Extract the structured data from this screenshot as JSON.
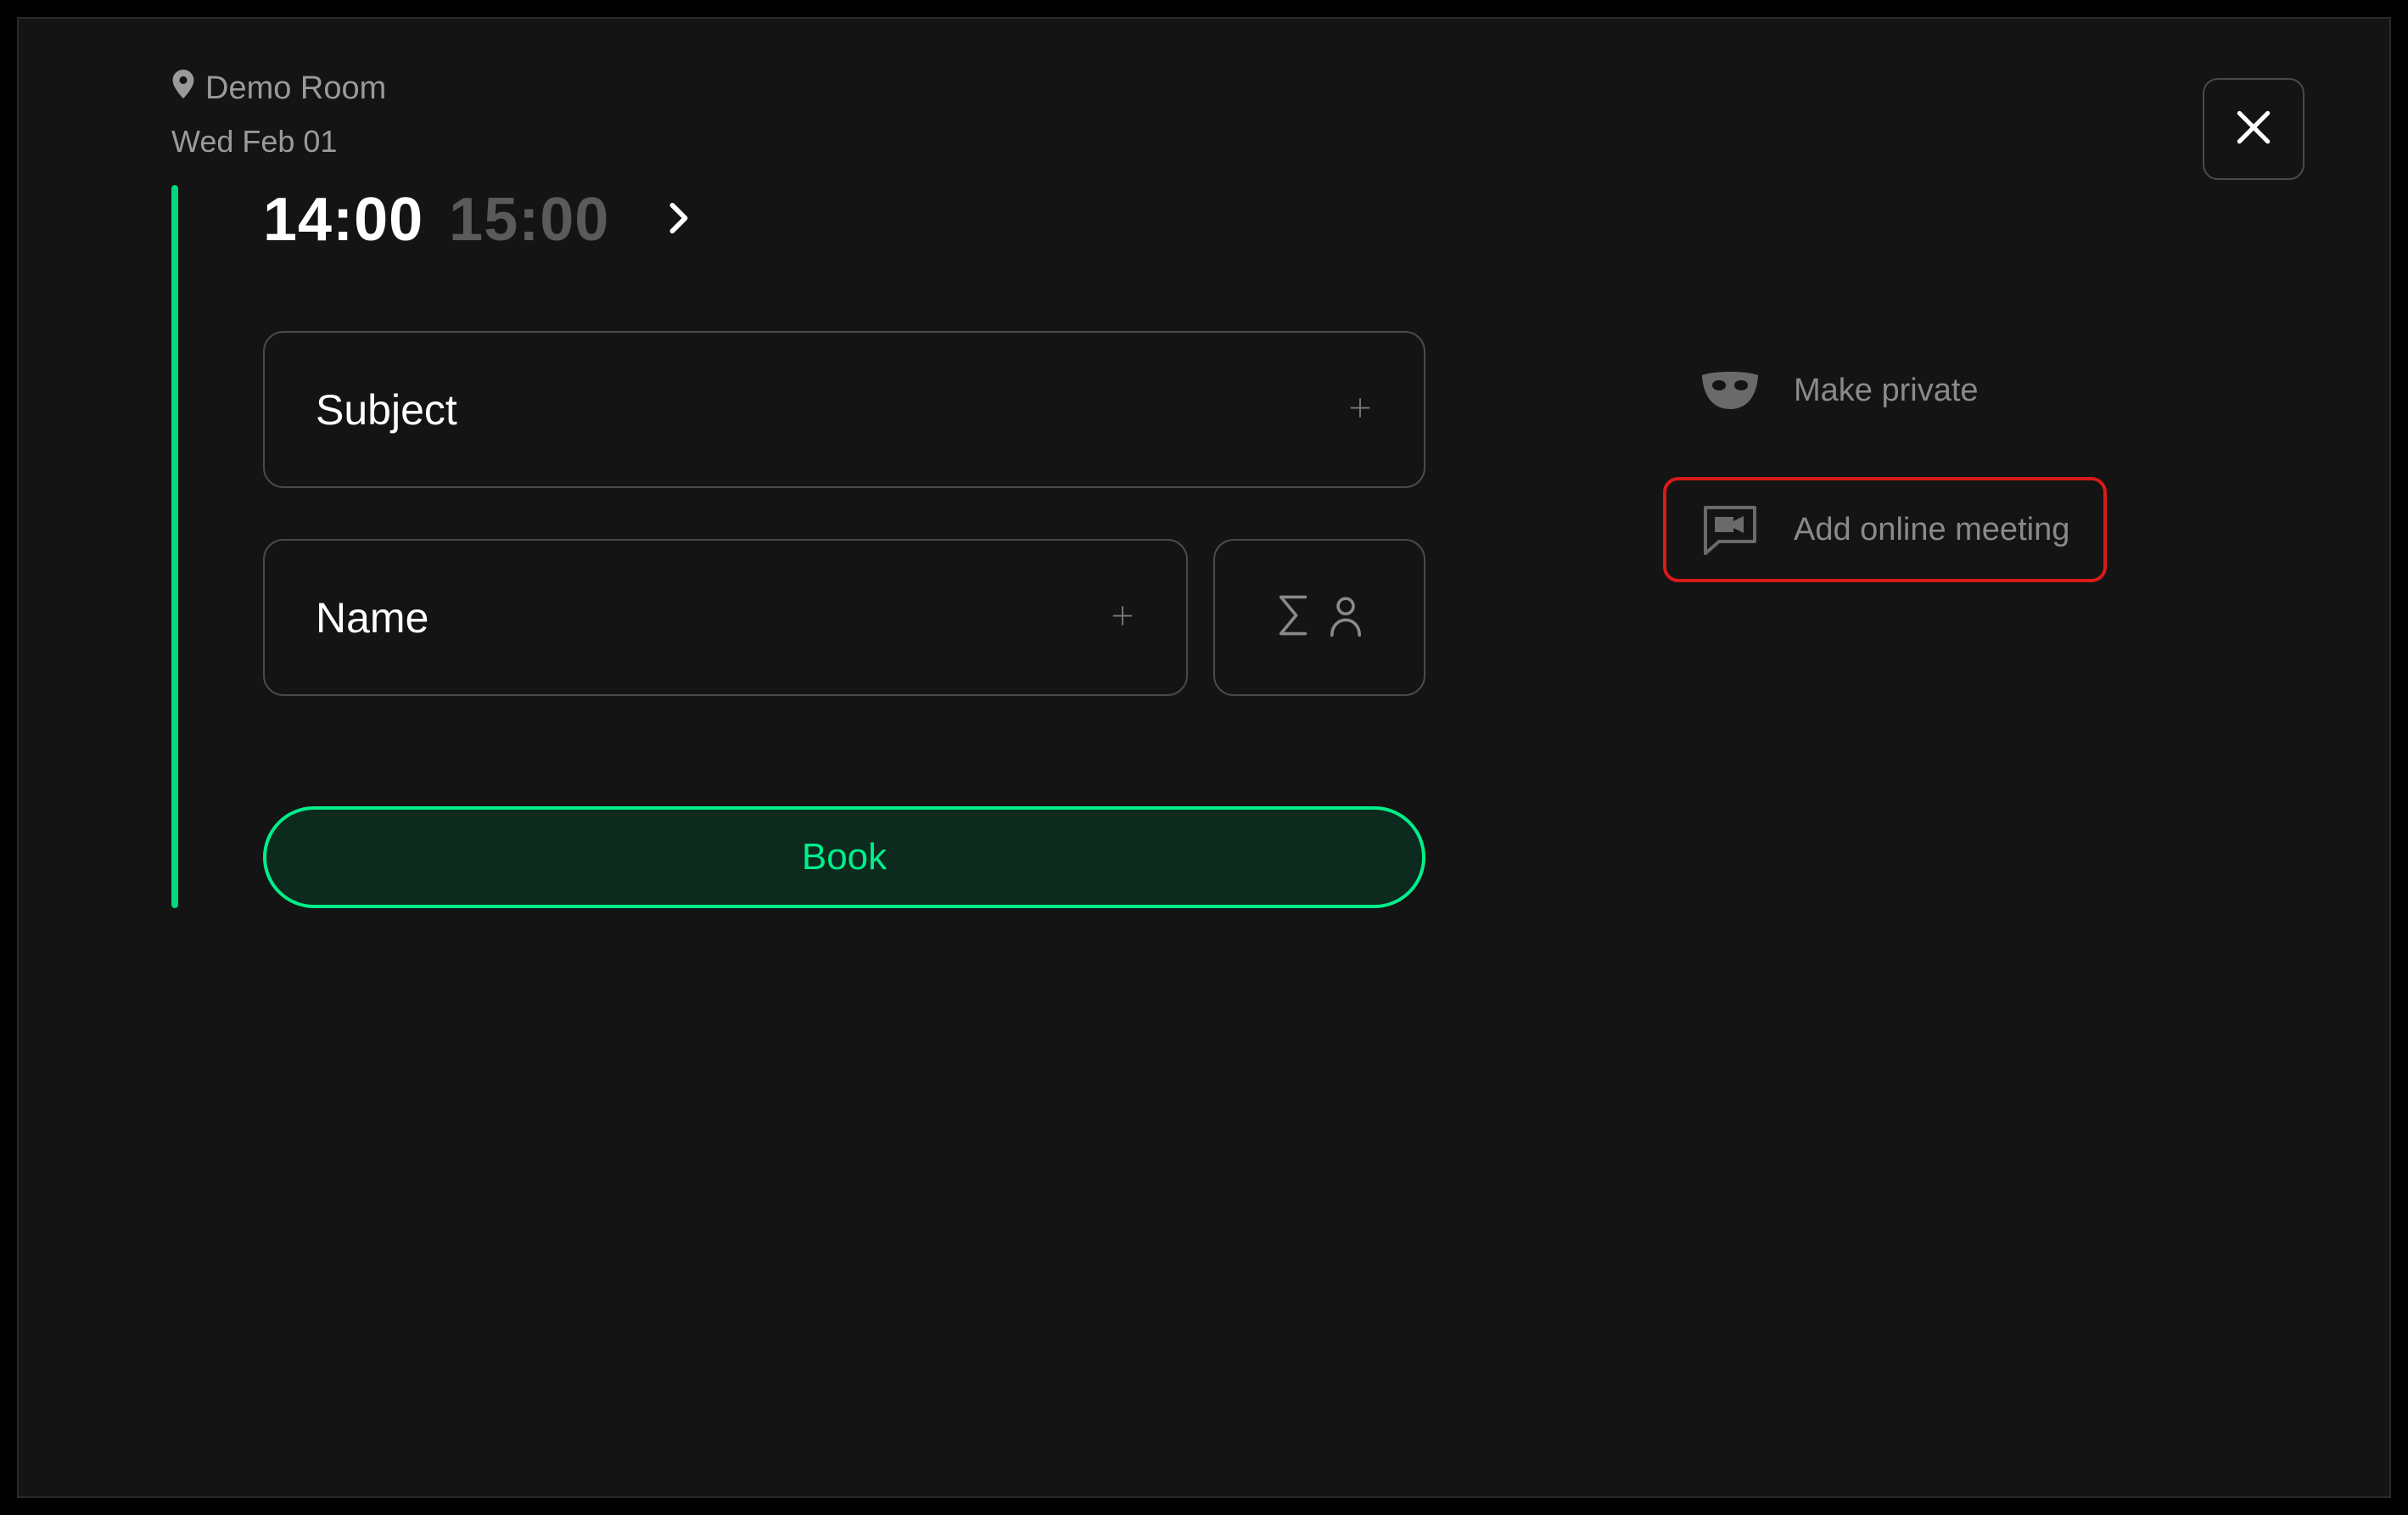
{
  "header": {
    "room_name": "Demo Room",
    "date": "Wed Feb 01"
  },
  "time": {
    "start": "14:00",
    "end": "15:00"
  },
  "form": {
    "subject_placeholder": "Subject",
    "name_placeholder": "Name",
    "book_label": "Book"
  },
  "options": {
    "make_private_label": "Make private",
    "add_online_meeting_label": "Add online meeting"
  },
  "colors": {
    "accent": "#00d97e",
    "highlight": "#d91a1a",
    "background": "#141414"
  }
}
